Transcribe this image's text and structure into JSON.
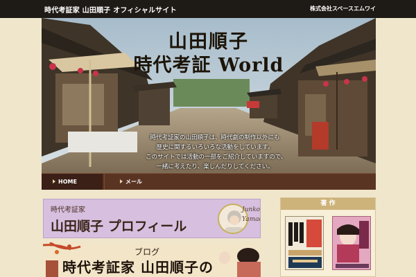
{
  "header": {
    "site_title": "時代考証家 山田順子 オフィシャルサイト",
    "company": "株式会社スペースエムワイ"
  },
  "hero": {
    "title_line1": "山田順子",
    "title_line2": "時代考証 World",
    "intro_lines": [
      "時代考証家の山田順子は、時代劇の制作以外にも",
      "歴史に関するいろいろな活動をしています。",
      "このサイトでは活動の一部をご紹介していますので、",
      "一緒に考えたり、楽しんだりしてください。"
    ]
  },
  "nav": {
    "items": [
      {
        "label": "HOME"
      },
      {
        "label": "メール"
      }
    ]
  },
  "profile_banner": {
    "subtitle": "時代考証家",
    "title": "山田順子 プロフィール",
    "signature_line1": "Junko",
    "signature_line2": "Yamada"
  },
  "blog_banner": {
    "subtitle": "ブログ",
    "title": "時代考証家 山田順子の"
  },
  "works": {
    "heading": "著 作"
  },
  "colors": {
    "topbar": "#1e1a16",
    "nav": "#5a3422",
    "page_bg": "#efe6cc",
    "works_header": "#cdb37a",
    "profile_banner": "#d6bfdf"
  }
}
